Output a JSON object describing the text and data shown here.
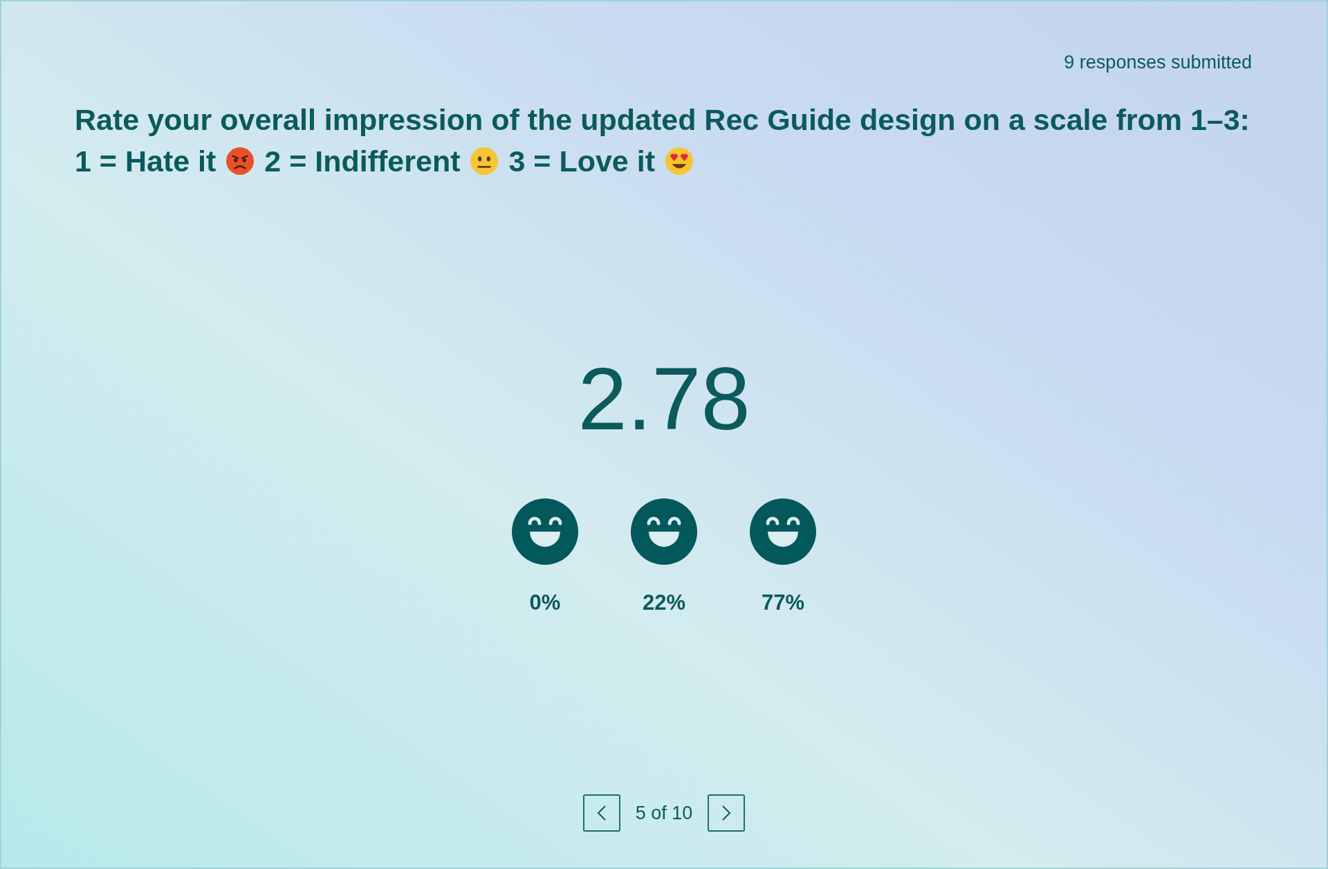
{
  "responses": "9 responses submitted",
  "question_lines": [
    [
      {
        "kind": "text",
        "text": "Rate your overall impression of the updated Rec Guide design on a scale from 1–3:"
      }
    ],
    [
      {
        "kind": "text",
        "text": "1 = Hate it"
      },
      {
        "kind": "angry"
      },
      {
        "kind": "text",
        "text": "2 = Indifferent"
      },
      {
        "kind": "neutral"
      },
      {
        "kind": "text",
        "text": "3 = Love it"
      },
      {
        "kind": "hearts"
      }
    ]
  ],
  "average": "2.78",
  "ratings": [
    {
      "percent": "0%"
    },
    {
      "percent": "22%"
    },
    {
      "percent": "77%"
    }
  ],
  "pager": {
    "label": "5 of 10"
  }
}
